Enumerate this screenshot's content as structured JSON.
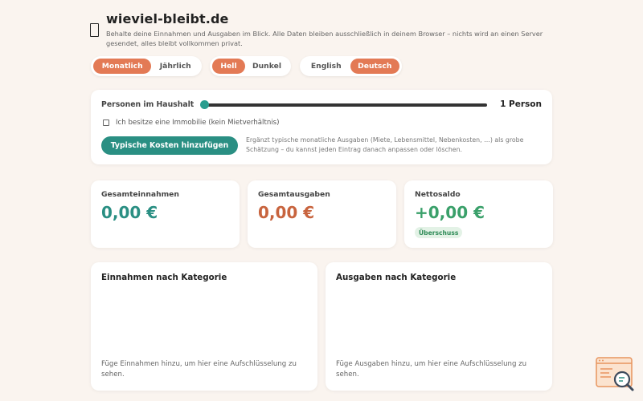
{
  "header": {
    "title": "wieviel-bleibt.de",
    "subtitle": "Behalte deine Einnahmen und Ausgaben im Blick. Alle Daten bleiben ausschließlich in deinem Browser – nichts wird an einen Server gesendet, alles bleibt vollkommen privat."
  },
  "toggles": {
    "period": {
      "options": [
        "Monatlich",
        "Jährlich"
      ],
      "active": "Monatlich"
    },
    "theme": {
      "options": [
        "Hell",
        "Dunkel"
      ],
      "active": "Hell"
    },
    "language": {
      "options": [
        "English",
        "Deutsch"
      ],
      "active": "Deutsch"
    }
  },
  "household": {
    "label": "Personen im Haushalt",
    "count_label": "1 Person",
    "slider_value": 1,
    "property_checkbox_label": "Ich besitze eine Immobilie (kein Mietverhältnis)",
    "property_checked": false,
    "add_button": "Typische Kosten hinzufügen",
    "add_hint": "Ergänzt typische monatliche Ausgaben (Miete, Lebensmittel, Nebenkosten, …) als grobe Schätzung – du kannst jeden Eintrag danach anpassen oder löschen."
  },
  "summary": {
    "income": {
      "label": "Gesamteinnahmen",
      "value": "0,00 €"
    },
    "expenses": {
      "label": "Gesamtausgaben",
      "value": "0,00 €"
    },
    "net": {
      "label": "Nettosaldo",
      "value": "+0,00 €",
      "badge": "Überschuss"
    }
  },
  "panels": {
    "income": {
      "title": "Einnahmen nach Kategorie",
      "empty": "Füge Einnahmen hinzu, um hier eine Aufschlüsselung zu sehen."
    },
    "expenses": {
      "title": "Ausgaben nach Kategorie",
      "empty": "Füge Ausgaben hinzu, um hier eine Aufschlüsselung zu sehen."
    }
  },
  "colors": {
    "accent": "#e37a55",
    "teal": "#2a8f83",
    "income_value": "#2a8f83",
    "expense_value": "#c8643e",
    "net_value": "#3aa06a",
    "background": "#faf4ef"
  }
}
